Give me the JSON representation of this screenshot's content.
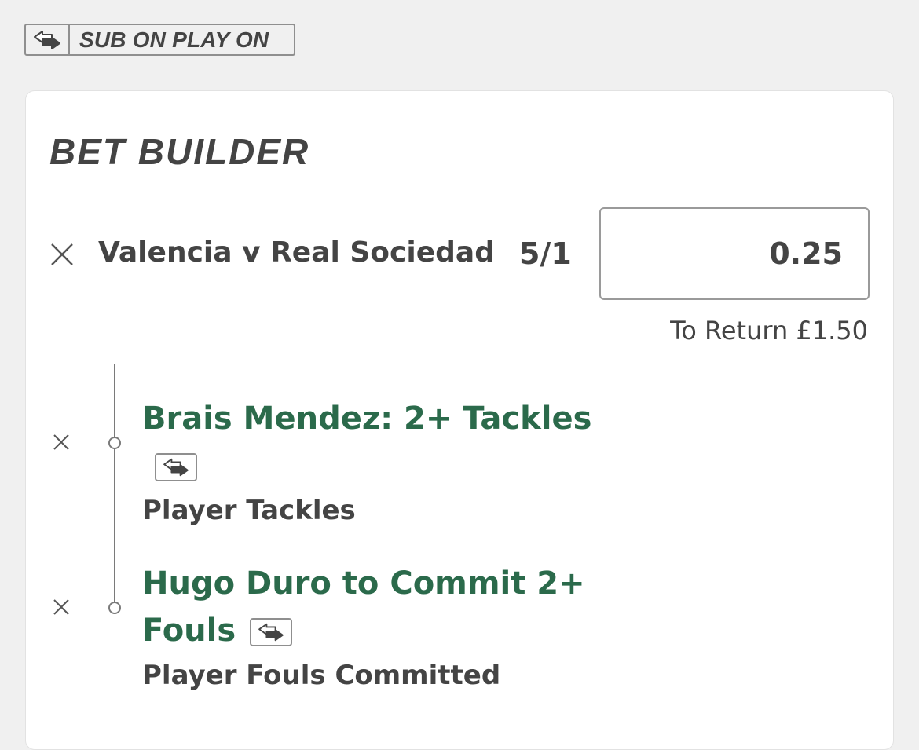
{
  "sub_badge": {
    "icon": "sub-on-icon",
    "label": "SUB ON PLAY ON"
  },
  "bet_builder": {
    "title": "BET BUILDER",
    "match": "Valencia v Real Sociedad",
    "odds": "5/1",
    "stake": "0.25",
    "to_return": "To Return £1.50",
    "legs": [
      {
        "selection_line1": "Brais Mendez: 2+ Tackles",
        "selection_line2": "",
        "market": "Player Tackles"
      },
      {
        "selection_line1": "Hugo Duro to Commit 2+",
        "selection_line2": "Fouls",
        "market": "Player Fouls Committed"
      }
    ]
  },
  "colors": {
    "selection_green": "#2b6a4b",
    "text_dark": "#444444",
    "background": "#f0f0f0"
  }
}
